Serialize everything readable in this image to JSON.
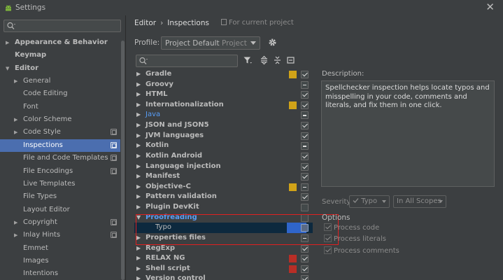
{
  "window": {
    "title": "Settings",
    "close_glyph": "✕"
  },
  "colors": {
    "accent": "#4b6eaf",
    "link_blue": "#589df6",
    "warning": "#d1a318",
    "error": "#b82e26",
    "highlight_box": "#e02020"
  },
  "sidebar": {
    "search_placeholder": "",
    "items": [
      {
        "label": "Appearance & Behavior",
        "level": 0,
        "arrow": "▶",
        "bold": true
      },
      {
        "label": "Keymap",
        "level": 0,
        "arrow": "",
        "bold": true
      },
      {
        "label": "Editor",
        "level": 0,
        "arrow": "▼",
        "bold": true
      },
      {
        "label": "General",
        "level": 1,
        "arrow": "▶"
      },
      {
        "label": "Code Editing",
        "level": 1,
        "arrow": ""
      },
      {
        "label": "Font",
        "level": 1,
        "arrow": ""
      },
      {
        "label": "Color Scheme",
        "level": 1,
        "arrow": "▶"
      },
      {
        "label": "Code Style",
        "level": 1,
        "arrow": "▶",
        "copy": true
      },
      {
        "label": "Inspections",
        "level": 1,
        "arrow": "",
        "copy": true,
        "selected": true
      },
      {
        "label": "File and Code Templates",
        "level": 1,
        "arrow": "",
        "copy": true
      },
      {
        "label": "File Encodings",
        "level": 1,
        "arrow": "",
        "copy": true
      },
      {
        "label": "Live Templates",
        "level": 1,
        "arrow": ""
      },
      {
        "label": "File Types",
        "level": 1,
        "arrow": ""
      },
      {
        "label": "Layout Editor",
        "level": 1,
        "arrow": ""
      },
      {
        "label": "Copyright",
        "level": 1,
        "arrow": "▶",
        "copy": true
      },
      {
        "label": "Inlay Hints",
        "level": 1,
        "arrow": "▶",
        "copy": true
      },
      {
        "label": "Emmet",
        "level": 1,
        "arrow": ""
      },
      {
        "label": "Images",
        "level": 1,
        "arrow": ""
      },
      {
        "label": "Intentions",
        "level": 1,
        "arrow": ""
      }
    ]
  },
  "breadcrumb": {
    "parts": [
      "Editor",
      "Inspections"
    ],
    "separator": "›",
    "note": "For current project"
  },
  "profile": {
    "label": "Profile:",
    "value": "Project Default",
    "value_suffix": "Project"
  },
  "tree": {
    "search_placeholder": "",
    "rows": [
      {
        "label": "Gradle",
        "arrow": "▶",
        "severity": "#d1a318",
        "check": "checked"
      },
      {
        "label": "Groovy",
        "arrow": "▶",
        "severity": "",
        "check": "partial"
      },
      {
        "label": "HTML",
        "arrow": "▶",
        "severity": "",
        "check": "checked"
      },
      {
        "label": "Internationalization",
        "arrow": "▶",
        "severity": "#d1a318",
        "check": "checked"
      },
      {
        "label": "Java",
        "arrow": "▶",
        "severity": "",
        "check": "partial",
        "style": "java"
      },
      {
        "label": "JSON and JSON5",
        "arrow": "▶",
        "severity": "",
        "check": "checked"
      },
      {
        "label": "JVM languages",
        "arrow": "▶",
        "severity": "",
        "check": "checked"
      },
      {
        "label": "Kotlin",
        "arrow": "▶",
        "severity": "",
        "check": "partial"
      },
      {
        "label": "Kotlin Android",
        "arrow": "▶",
        "severity": "",
        "check": "checked"
      },
      {
        "label": "Language injection",
        "arrow": "▶",
        "severity": "",
        "check": "checked"
      },
      {
        "label": "Manifest",
        "arrow": "▶",
        "severity": "",
        "check": "checked"
      },
      {
        "label": "Objective-C",
        "arrow": "▶",
        "severity": "#d1a318",
        "check": "partial"
      },
      {
        "label": "Pattern validation",
        "arrow": "▶",
        "severity": "",
        "check": "checked"
      },
      {
        "label": "Plugin DevKit",
        "arrow": "▶",
        "severity": "",
        "check": "none"
      },
      {
        "label": "Proofreading",
        "arrow": "▼",
        "severity": "",
        "check": "none",
        "style": "proof"
      },
      {
        "label": "Typo",
        "arrow": "",
        "severity": "",
        "check": "none",
        "style": "child"
      },
      {
        "label": "Properties files",
        "arrow": "▶",
        "severity": "",
        "check": "partial"
      },
      {
        "label": "RegExp",
        "arrow": "▶",
        "severity": "",
        "check": "checked"
      },
      {
        "label": "RELAX NG",
        "arrow": "▶",
        "severity": "#b82e26",
        "check": "checked"
      },
      {
        "label": "Shell script",
        "arrow": "▶",
        "severity": "#b82e26",
        "check": "checked"
      },
      {
        "label": "Version control",
        "arrow": "▶",
        "severity": "",
        "check": "checked"
      }
    ]
  },
  "description": {
    "label": "Description:",
    "text": "Spellchecker inspection helps locate typos and misspelling in your code, comments and literals, and fix them in one click."
  },
  "severity": {
    "label": "Severity:",
    "value": "Typo",
    "scope": "In All Scopes"
  },
  "options": {
    "title": "Options",
    "items": [
      "Process code",
      "Process literals",
      "Process comments"
    ]
  },
  "icons": {
    "title": "android-icon",
    "search": "search-icon",
    "settings": "gear-icon",
    "filter": "filter-icon",
    "expand": "expand-all-icon",
    "collapse": "collapse-all-icon",
    "reset": "reset-icon"
  }
}
